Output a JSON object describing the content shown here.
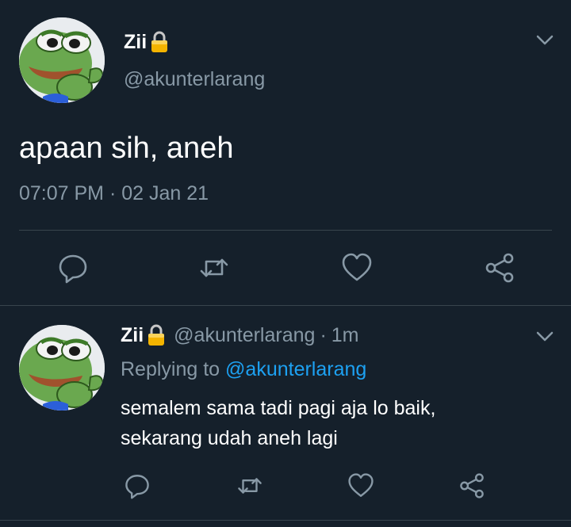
{
  "main_tweet": {
    "author_name": "Zii",
    "handle": "@akunterlarang",
    "text": "apaan sih, aneh",
    "timestamp": "07:07 PM · 02 Jan 21",
    "lock_icon": "lock-icon",
    "actions": [
      "reply-icon",
      "retweet-icon",
      "like-icon",
      "share-icon"
    ]
  },
  "reply_tweet": {
    "author_name": "Zii",
    "handle": "@akunterlarang",
    "separator": "·",
    "time": "1m",
    "replying_prefix": "Replying to",
    "replying_to": "@akunterlarang",
    "text_line1": "semalem sama tadi pagi aja lo baik,",
    "text_line2": "sekarang udah aneh lagi",
    "actions": [
      "reply-icon",
      "retweet-icon",
      "like-icon",
      "share-icon"
    ]
  },
  "colors": {
    "background": "#15202b",
    "secondary_text": "#8899a6",
    "link": "#1da1f2",
    "divider": "#38444d"
  }
}
